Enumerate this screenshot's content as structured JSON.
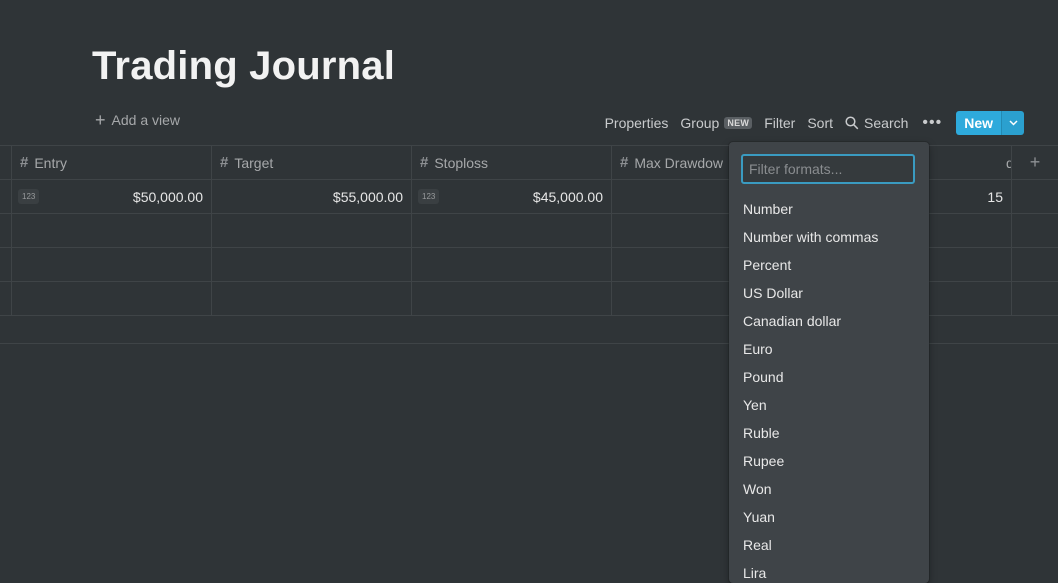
{
  "page": {
    "title": "Trading Journal"
  },
  "view_bar": {
    "add_view_label": "Add a view"
  },
  "toolbar": {
    "properties": "Properties",
    "group": "Group",
    "group_badge": "NEW",
    "filter": "Filter",
    "sort": "Sort",
    "search": "Search",
    "more": "•••",
    "new": "New"
  },
  "table": {
    "columns": [
      "Entry",
      "Target",
      "Stoploss",
      "Max Drawdow",
      "de"
    ],
    "rows": [
      {
        "entry_tag": "123",
        "entry": "$50,000.00",
        "target": "$55,000.00",
        "stoploss_tag": "123",
        "stoploss": "$45,000.00",
        "max_drawdown": "",
        "last": "15"
      }
    ]
  },
  "format_menu": {
    "placeholder": "Filter formats...",
    "options": [
      "Number",
      "Number with commas",
      "Percent",
      "US Dollar",
      "Canadian dollar",
      "Euro",
      "Pound",
      "Yen",
      "Ruble",
      "Rupee",
      "Won",
      "Yuan",
      "Real",
      "Lira"
    ]
  },
  "colors": {
    "accent": "#2eaadc",
    "background": "#2f3437",
    "menu_bg": "#3f4448"
  }
}
